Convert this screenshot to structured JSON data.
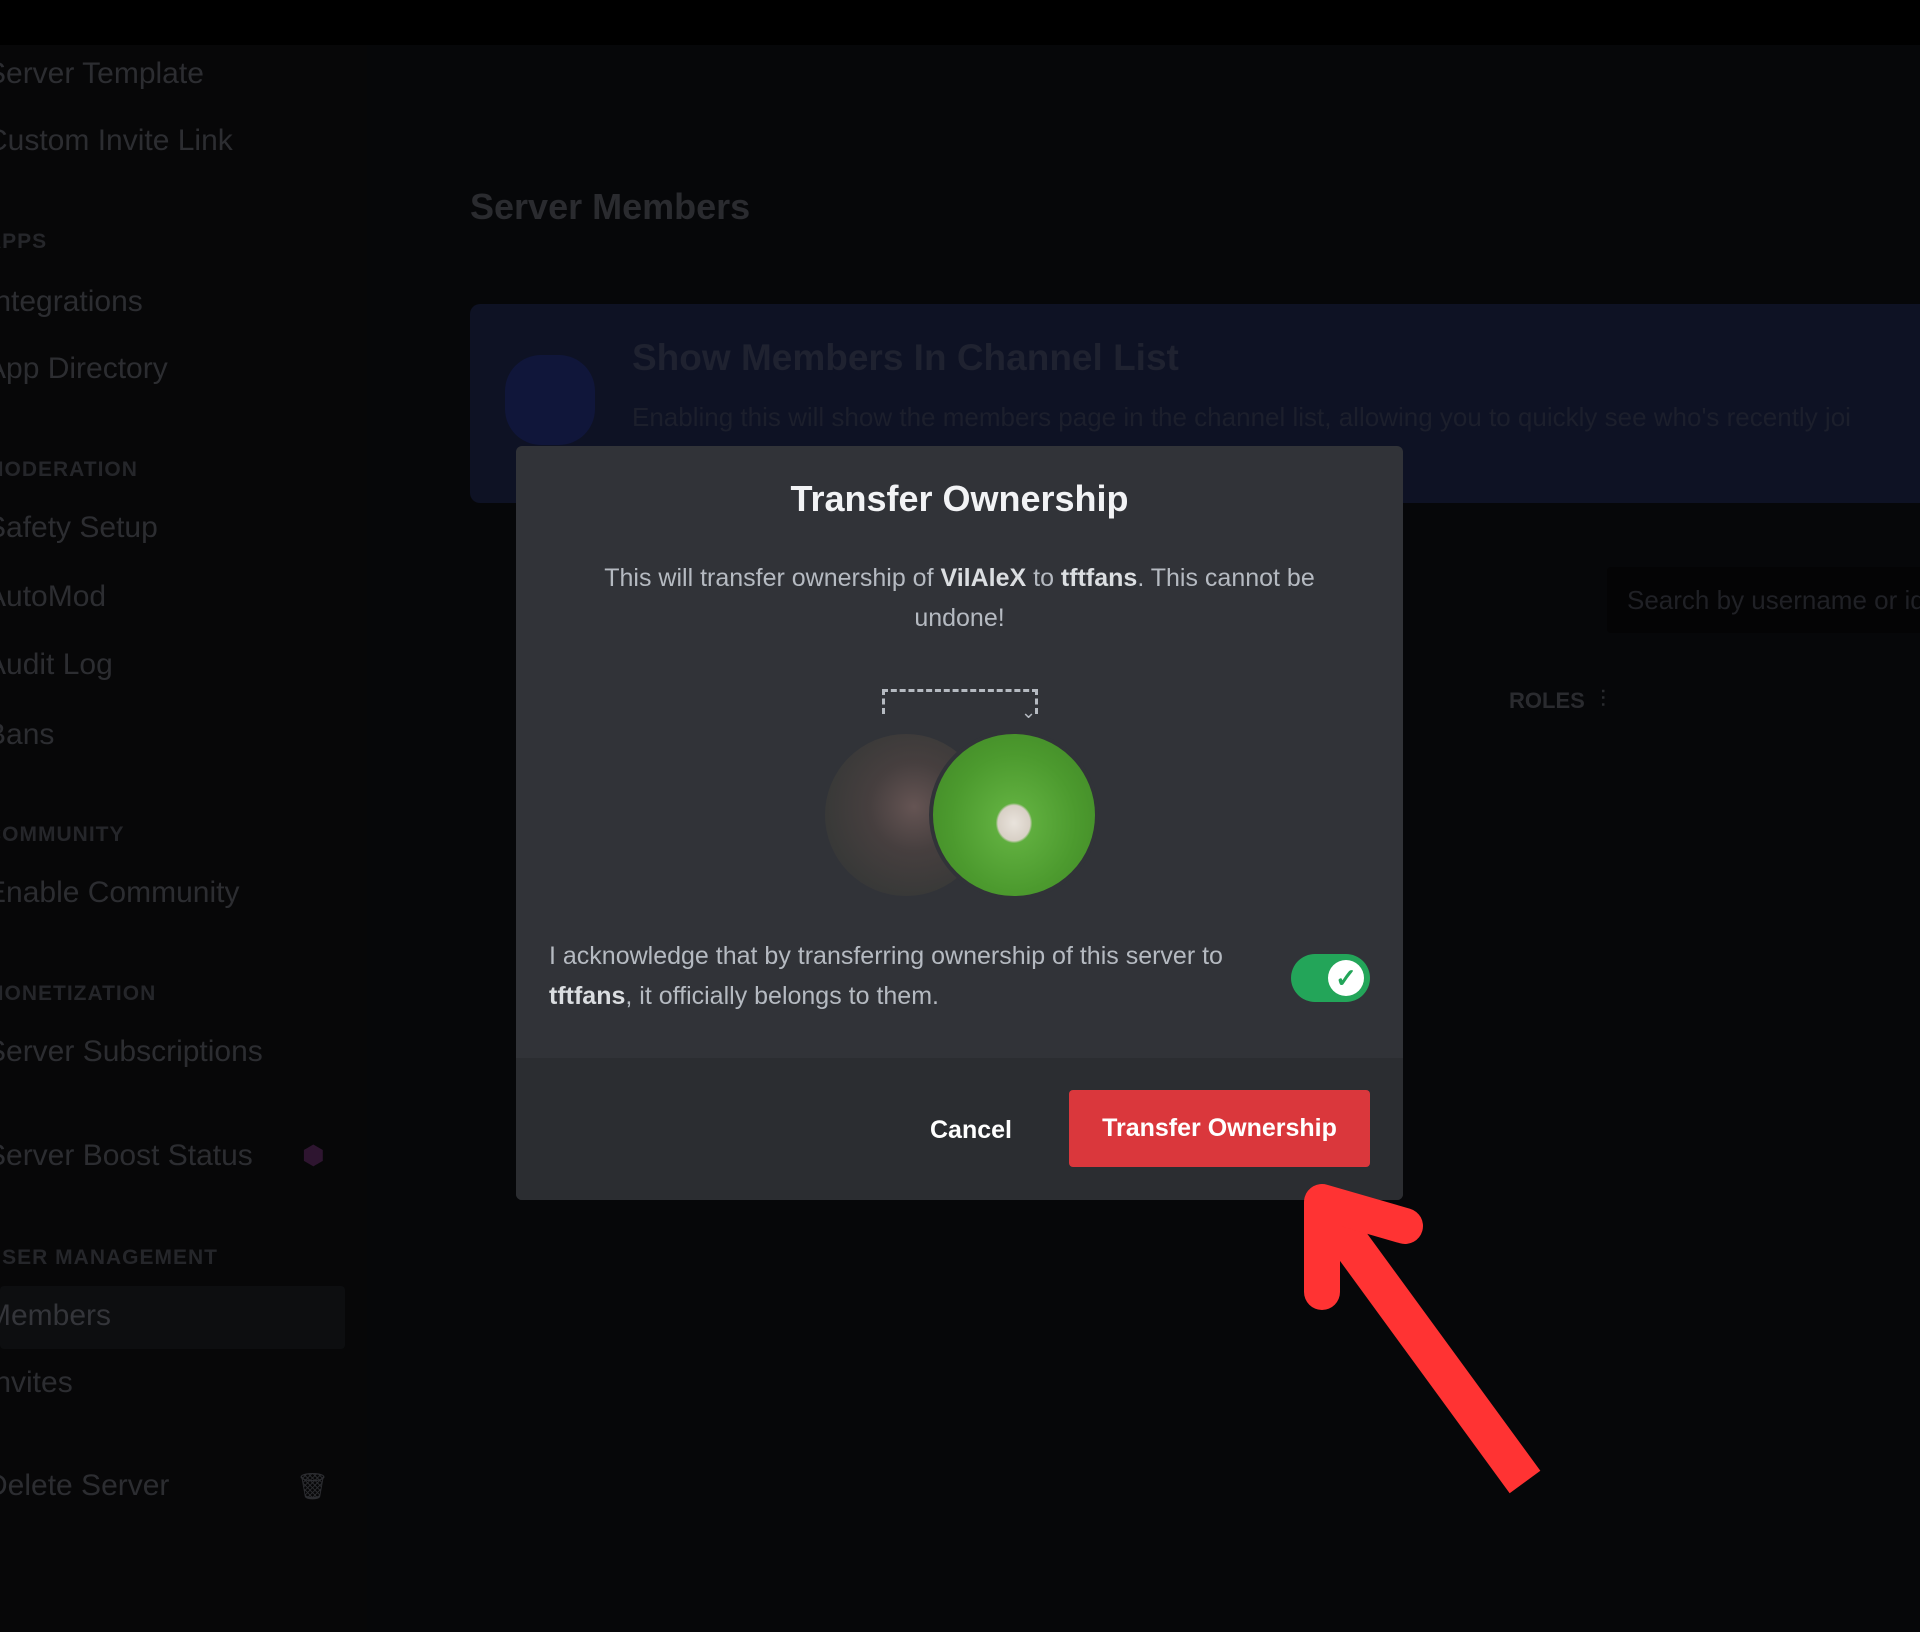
{
  "sidebar": {
    "items": [
      {
        "label": "Server Template"
      },
      {
        "label": "Custom Invite Link"
      },
      {
        "header": "APPS"
      },
      {
        "label": "Integrations"
      },
      {
        "label": "App Directory"
      },
      {
        "header": "MODERATION"
      },
      {
        "label": "Safety Setup"
      },
      {
        "label": "AutoMod"
      },
      {
        "label": "Audit Log"
      },
      {
        "label": "Bans"
      },
      {
        "header": "COMMUNITY"
      },
      {
        "label": "Enable Community"
      },
      {
        "header": "MONETIZATION"
      },
      {
        "label": "Server Subscriptions"
      },
      {
        "label": "Server Boost Status",
        "icon": "boost-gem-icon"
      },
      {
        "header": "USER MANAGEMENT"
      },
      {
        "label": "Members",
        "selected": true
      },
      {
        "label": "Invites"
      },
      {
        "label": "Delete Server",
        "icon": "trash-icon"
      }
    ]
  },
  "main": {
    "title": "Server Members",
    "banner": {
      "title": "Show Members In Channel List",
      "description": "Enabling this will show the members page in the channel list, allowing you to quickly see who's recently joi"
    },
    "search_placeholder": "Search by username or id",
    "columns": {
      "roles": "ROLES"
    }
  },
  "modal": {
    "title": "Transfer Ownership",
    "body_prefix": "This will transfer ownership of ",
    "server_name": "VilAleX",
    "body_mid": " to ",
    "new_owner": "tftfans",
    "body_suffix": ". This cannot be undone!",
    "ack_prefix": "I acknowledge that by transferring ownership of this server to ",
    "ack_owner": "tftfans",
    "ack_suffix": ", it officially belongs to them.",
    "ack_toggle_on": true,
    "cancel_label": "Cancel",
    "confirm_label": "Transfer Ownership"
  },
  "colors": {
    "danger": "#da373c",
    "toggle_on": "#23a559",
    "annotation_arrow": "#ff3333",
    "modal_bg": "#313338"
  }
}
